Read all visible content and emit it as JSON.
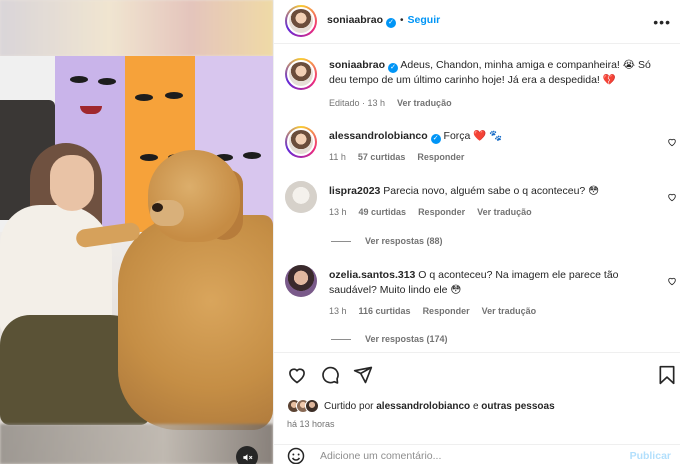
{
  "post": {
    "author": "soniaabrao",
    "separator": "•",
    "follow_label": "Seguir",
    "more_label": "•••"
  },
  "caption": {
    "username": "soniaabrao",
    "text": "Adeus, Chandon, minha amiga e companheira! 😭 Só deu tempo de um último carinho hoje! Já era a despedida! 💔",
    "edited": "Editado · 13 h",
    "translate": "Ver tradução"
  },
  "comments": [
    {
      "username": "alessandrolobianco",
      "verified": true,
      "text": "Força ❤️ 🐾",
      "time": "11 h",
      "likes": "57 curtidas",
      "reply": "Responder"
    },
    {
      "username": "lispra2023",
      "verified": false,
      "text": "Parecia novo, alguém sabe o q aconteceu? 😳",
      "time": "13 h",
      "likes": "49 curtidas",
      "reply": "Responder",
      "translate": "Ver tradução",
      "view_replies": "Ver respostas (88)"
    },
    {
      "username": "ozelia.santos.313",
      "verified": false,
      "text": "O q aconteceu? Na imagem ele parece tão saudável? Muito lindo ele 😳",
      "time": "13 h",
      "likes": "116 curtidas",
      "reply": "Responder",
      "translate": "Ver tradução",
      "view_replies": "Ver respostas (174)"
    }
  ],
  "liked_by": {
    "prefix": "Curtido por",
    "user": "alessandrolobianco",
    "middle": "e",
    "others": "outras pessoas"
  },
  "posted_time": "há 13 horas",
  "add_comment": {
    "placeholder": "Adicione um comentário...",
    "publish_label": "Publicar"
  },
  "icons": [
    "heart-icon",
    "comment-icon",
    "share-icon",
    "bookmark-icon",
    "emoji-icon",
    "mute-icon",
    "more-icon",
    "verified-icon"
  ],
  "colors": {
    "link_blue": "#0095f6",
    "like_red": "#ed4956",
    "muted_text": "#737373",
    "publish_disabled": "#b2dffc"
  }
}
